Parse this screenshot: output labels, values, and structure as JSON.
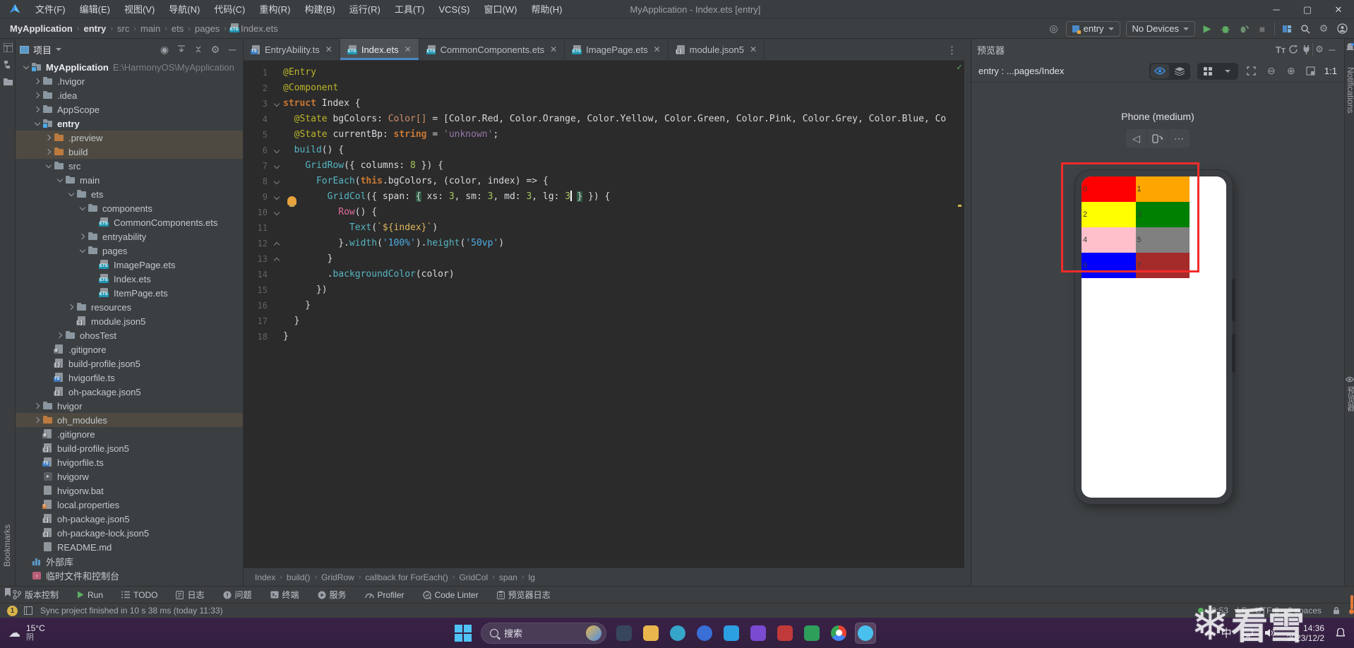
{
  "colors": {
    "accent_blue": "#3574f0",
    "run_green": "#5fad65",
    "selection_red": "#f22b2b",
    "tab_underline": "#4a88c7"
  },
  "title_bar": {
    "title": "MyApplication - Index.ets [entry]",
    "menus": [
      "文件(F)",
      "编辑(E)",
      "视图(V)",
      "导航(N)",
      "代码(C)",
      "重构(R)",
      "构建(B)",
      "运行(R)",
      "工具(T)",
      "VCS(S)",
      "窗口(W)",
      "帮助(H)"
    ],
    "window_buttons": [
      "─",
      "▢",
      "✕"
    ]
  },
  "breadcrumbs": [
    {
      "label": "MyApplication",
      "bold": true
    },
    {
      "label": "entry",
      "bold": true
    },
    {
      "label": "src"
    },
    {
      "label": "main"
    },
    {
      "label": "ets"
    },
    {
      "label": "pages"
    },
    {
      "label": "Index.ets",
      "icon": "ets"
    }
  ],
  "toolbar": {
    "run_config": "entry",
    "device": "No Devices"
  },
  "project_panel": {
    "header": "项目",
    "tree": [
      {
        "label": "MyApplication",
        "suffix": "E:\\HarmonyOS\\MyApplication",
        "icon": "folder-badged",
        "arrow": "open",
        "indent": 0,
        "bold": true
      },
      {
        "label": ".hvigor",
        "icon": "folder",
        "arrow": "closed",
        "indent": 1
      },
      {
        "label": ".idea",
        "icon": "folder",
        "arrow": "closed",
        "indent": 1
      },
      {
        "label": "AppScope",
        "icon": "folder",
        "arrow": "closed",
        "indent": 1
      },
      {
        "label": "entry",
        "icon": "folder-badged",
        "arrow": "open",
        "indent": 1,
        "bold": true
      },
      {
        "label": ".preview",
        "icon": "folder-orange",
        "arrow": "closed",
        "indent": 2,
        "hl": true
      },
      {
        "label": "build",
        "icon": "folder-orange",
        "arrow": "closed",
        "indent": 2,
        "hl": true
      },
      {
        "label": "src",
        "icon": "folder",
        "arrow": "open",
        "indent": 2
      },
      {
        "label": "main",
        "icon": "folder",
        "arrow": "open",
        "indent": 3
      },
      {
        "label": "ets",
        "icon": "folder",
        "arrow": "open",
        "indent": 4
      },
      {
        "label": "components",
        "icon": "folder",
        "arrow": "open",
        "indent": 5
      },
      {
        "label": "CommonComponents.ets",
        "icon": "ets",
        "indent": 6
      },
      {
        "label": "entryability",
        "icon": "folder",
        "arrow": "closed",
        "indent": 5
      },
      {
        "label": "pages",
        "icon": "folder",
        "arrow": "open",
        "indent": 5
      },
      {
        "label": "ImagePage.ets",
        "icon": "ets",
        "indent": 6
      },
      {
        "label": "Index.ets",
        "icon": "ets",
        "indent": 6
      },
      {
        "label": "ItemPage.ets",
        "icon": "ets",
        "indent": 6
      },
      {
        "label": "resources",
        "icon": "folder",
        "arrow": "closed",
        "indent": 4
      },
      {
        "label": "module.json5",
        "icon": "json",
        "indent": 4
      },
      {
        "label": "ohosTest",
        "icon": "folder",
        "arrow": "closed",
        "indent": 3
      },
      {
        "label": ".gitignore",
        "icon": "git",
        "indent": 2
      },
      {
        "label": "build-profile.json5",
        "icon": "json",
        "indent": 2
      },
      {
        "label": "hvigorfile.ts",
        "icon": "ts",
        "indent": 2
      },
      {
        "label": "oh-package.json5",
        "icon": "json",
        "indent": 2
      },
      {
        "label": "hvigor",
        "icon": "folder",
        "arrow": "closed",
        "indent": 1
      },
      {
        "label": "oh_modules",
        "icon": "folder-orange",
        "arrow": "closed",
        "indent": 1,
        "hl": true
      },
      {
        "label": ".gitignore",
        "icon": "git",
        "indent": 1
      },
      {
        "label": "build-profile.json5",
        "icon": "json",
        "indent": 1
      },
      {
        "label": "hvigorfile.ts",
        "icon": "ts",
        "indent": 1
      },
      {
        "label": "hvigorw",
        "icon": "exe",
        "indent": 1
      },
      {
        "label": "hvigorw.bat",
        "icon": "bat",
        "indent": 1
      },
      {
        "label": "local.properties",
        "icon": "prop",
        "indent": 1
      },
      {
        "label": "oh-package.json5",
        "icon": "json",
        "indent": 1
      },
      {
        "label": "oh-package-lock.json5",
        "icon": "json",
        "indent": 1
      },
      {
        "label": "README.md",
        "icon": "md",
        "indent": 1
      },
      {
        "label": "外部库",
        "icon": "lib",
        "indent": 0
      },
      {
        "label": "临时文件和控制台",
        "icon": "console",
        "indent": 0
      }
    ]
  },
  "tabs": [
    {
      "label": "EntryAbility.ts",
      "icon": "ts",
      "active": false
    },
    {
      "label": "Index.ets",
      "icon": "ets",
      "active": true
    },
    {
      "label": "CommonComponents.ets",
      "icon": "ets",
      "active": false
    },
    {
      "label": "ImagePage.ets",
      "icon": "ets",
      "active": false
    },
    {
      "label": "module.json5",
      "icon": "json",
      "active": false
    }
  ],
  "editor": {
    "lines": [
      {
        "n": 1,
        "tk": [
          [
            "d",
            "@Entry"
          ]
        ]
      },
      {
        "n": 2,
        "tk": [
          [
            "d",
            "@Component"
          ]
        ]
      },
      {
        "n": 3,
        "fold": "v",
        "tk": [
          [
            "k",
            "struct "
          ],
          [
            "p",
            "Index "
          ],
          [
            "p",
            "{"
          ]
        ]
      },
      {
        "n": 4,
        "tk": [
          [
            "p",
            "  "
          ],
          [
            "d",
            "@State"
          ],
          [
            "p",
            " bgColors: "
          ],
          [
            "t",
            "Color[]"
          ],
          [
            "p",
            " = [Color.Red, Color.Orange, Color.Yellow, Color.Green, Color.Pink, Color.Grey, Color.Blue, Co"
          ]
        ]
      },
      {
        "n": 5,
        "tk": [
          [
            "p",
            "  "
          ],
          [
            "d",
            "@State"
          ],
          [
            "p",
            " currentBp: "
          ],
          [
            "k",
            "string"
          ],
          [
            "p",
            " = "
          ],
          [
            "s1",
            "'unknown'"
          ],
          [
            "p",
            ";"
          ]
        ]
      },
      {
        "n": 6,
        "fold": "v",
        "tk": [
          [
            "f",
            "  build"
          ],
          [
            "p",
            "() {"
          ]
        ]
      },
      {
        "n": 7,
        "fold": "v",
        "tk": [
          [
            "p",
            "    "
          ],
          [
            "f",
            "GridRow"
          ],
          [
            "p",
            "({ columns: "
          ],
          [
            "n8",
            "8"
          ],
          [
            "p",
            " }) {"
          ]
        ]
      },
      {
        "n": 8,
        "fold": "v",
        "tk": [
          [
            "p",
            "      "
          ],
          [
            "f",
            "ForEach"
          ],
          [
            "p",
            "("
          ],
          [
            "k",
            "this"
          ],
          [
            "p",
            ".bgColors, (color, index) => {"
          ]
        ]
      },
      {
        "n": 9,
        "fold": "v",
        "bulb": true,
        "tk": [
          [
            "p",
            "        "
          ],
          [
            "f",
            "GridCol"
          ],
          [
            "p",
            "({ span: "
          ],
          [
            "bm",
            "{"
          ],
          [
            "p",
            " xs: "
          ],
          [
            "n8",
            "3"
          ],
          [
            "p",
            ", sm: "
          ],
          [
            "n8",
            "3"
          ],
          [
            "p",
            ", md: "
          ],
          [
            "n8",
            "3"
          ],
          [
            "p",
            ", lg: "
          ],
          [
            "n8",
            "3"
          ],
          [
            "cr",
            ""
          ],
          [
            "p",
            " "
          ],
          [
            "bm",
            "}"
          ],
          [
            "p",
            " }) {"
          ]
        ]
      },
      {
        "n": 10,
        "fold": "v",
        "tk": [
          [
            "p",
            "          "
          ],
          [
            "c",
            "Row"
          ],
          [
            "p",
            "() {"
          ]
        ]
      },
      {
        "n": 11,
        "tk": [
          [
            "p",
            "            "
          ],
          [
            "f",
            "Text"
          ],
          [
            "p",
            "("
          ],
          [
            "s3",
            "`${index}`"
          ],
          [
            "p",
            ")"
          ]
        ]
      },
      {
        "n": 12,
        "fold": "u",
        "tk": [
          [
            "p",
            "          }."
          ],
          [
            "f",
            "width"
          ],
          [
            "p",
            "("
          ],
          [
            "s2",
            "'100%'"
          ],
          [
            "p",
            ")."
          ],
          [
            "f",
            "height"
          ],
          [
            "p",
            "("
          ],
          [
            "s2",
            "'50vp'"
          ],
          [
            "p",
            ")"
          ]
        ]
      },
      {
        "n": 13,
        "fold": "u",
        "tk": [
          [
            "p",
            "        }"
          ]
        ]
      },
      {
        "n": 14,
        "tk": [
          [
            "p",
            "        ."
          ],
          [
            "f",
            "backgroundColor"
          ],
          [
            "p",
            "(color)"
          ]
        ]
      },
      {
        "n": 15,
        "tk": [
          [
            "p",
            "      })"
          ]
        ]
      },
      {
        "n": 16,
        "tk": [
          [
            "p",
            "    }"
          ]
        ]
      },
      {
        "n": 17,
        "tk": [
          [
            "p",
            "  }"
          ]
        ]
      },
      {
        "n": 18,
        "tk": [
          [
            "p",
            "}"
          ]
        ]
      }
    ]
  },
  "bottom_breadcrumb": [
    "Index",
    "build()",
    "GridRow",
    "callback for ForEach()",
    "GridCol",
    "span",
    "lg"
  ],
  "bottom_tools": [
    {
      "icon": "branch",
      "label": "版本控制"
    },
    {
      "icon": "play",
      "label": "Run"
    },
    {
      "icon": "todo",
      "label": "TODO"
    },
    {
      "icon": "note",
      "label": "日志"
    },
    {
      "icon": "error",
      "label": "问题"
    },
    {
      "icon": "terminal",
      "label": "终端"
    },
    {
      "icon": "service",
      "label": "服务"
    },
    {
      "icon": "gauge",
      "label": "Profiler"
    },
    {
      "icon": "linter",
      "label": "Code Linter"
    },
    {
      "icon": "log",
      "label": "预览器日志"
    }
  ],
  "status_bar": {
    "badge": "1",
    "message": "Sync project finished in 10 s 38 ms (today 11:33)",
    "right": [
      "9:53",
      "LF",
      "UTF-8",
      "2 spaces"
    ]
  },
  "preview": {
    "panel_title": "预览器",
    "target": "entry : ...pages/Index",
    "device_label": "Phone (medium)",
    "zoom_label": "1:1",
    "grid_cells": [
      {
        "index": "0",
        "color": "#FF0000"
      },
      {
        "index": "1",
        "color": "#FFA500"
      },
      {
        "index": "2",
        "color": "#FFFF00"
      },
      {
        "index": "3",
        "color": "#008000"
      },
      {
        "index": "4",
        "color": "#FFC0CB"
      },
      {
        "index": "5",
        "color": "#808080"
      },
      {
        "index": "6",
        "color": "#0000FF"
      },
      {
        "index": "7",
        "color": "#A52A2A"
      }
    ]
  },
  "right_strip": {
    "notifications_label": "Notifications",
    "preview_label": "预览器"
  },
  "left_strip": {
    "bookmarks_label": "Bookmarks"
  },
  "taskbar": {
    "weather_temp": "15°C",
    "weather_desc": "阴",
    "search_placeholder": "搜索",
    "time": "14:36",
    "date": "2023/12/2",
    "input_method": "中",
    "apps": [
      {
        "name": "task-view",
        "color": "#37465c"
      },
      {
        "name": "file-explorer",
        "color": "#e8b64c"
      },
      {
        "name": "edge",
        "color": "#35a5c9",
        "round": true
      },
      {
        "name": "phone-link",
        "color": "#3a6fd8",
        "round": true
      },
      {
        "name": "vscode",
        "color": "#2c9fe0"
      },
      {
        "name": "devtools-purple",
        "color": "#7a4bd0"
      },
      {
        "name": "reader-red",
        "color": "#c03a3a"
      },
      {
        "name": "dev-green",
        "color": "#2e9e5b"
      },
      {
        "name": "chrome",
        "color": "chrome",
        "round": true
      },
      {
        "name": "deveco",
        "color": "#49c0ee",
        "round": true,
        "active": true
      }
    ]
  },
  "watermark": {
    "text": "看雪"
  }
}
